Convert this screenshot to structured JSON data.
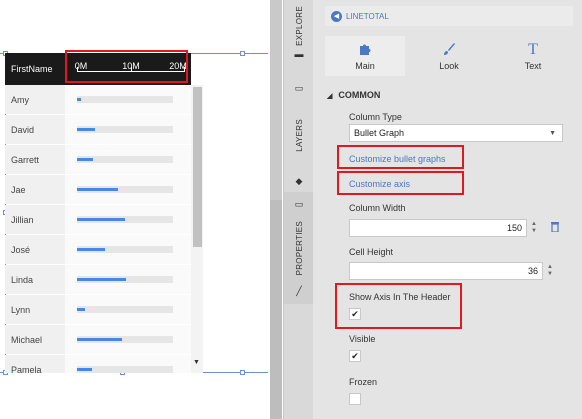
{
  "grid": {
    "header": {
      "first_name": "FirstName"
    },
    "axis": {
      "ticks": [
        "0M",
        "10M",
        "20M"
      ]
    },
    "rows": [
      {
        "name": "Amy",
        "value": 0.04
      },
      {
        "name": "David",
        "value": 0.19
      },
      {
        "name": "Garrett",
        "value": 0.17
      },
      {
        "name": "Jae",
        "value": 0.43
      },
      {
        "name": "Jillian",
        "value": 0.5
      },
      {
        "name": "José",
        "value": 0.29
      },
      {
        "name": "Linda",
        "value": 0.51
      },
      {
        "name": "Lynn",
        "value": 0.08
      },
      {
        "name": "Michael",
        "value": 0.47
      },
      {
        "name": "Pamela",
        "value": 0.16
      }
    ],
    "bar_color": "#4a86e8"
  },
  "side_tabs": {
    "explore": "EXPLORE",
    "layers": "LAYERS",
    "properties": "PROPERTIES"
  },
  "panel": {
    "back_label": "LINETOTAL",
    "tabs": [
      {
        "label": "Main",
        "icon": "puzzle-icon"
      },
      {
        "label": "Look",
        "icon": "brush-icon"
      },
      {
        "label": "Text",
        "icon": "text-icon"
      }
    ],
    "section": "COMMON",
    "column_type": {
      "label": "Column Type",
      "value": "Bullet Graph"
    },
    "customize_bullet_graphs": "Customize bullet graphs",
    "customize_axis": "Customize axis",
    "column_width": {
      "label": "Column Width",
      "value": "150"
    },
    "cell_height": {
      "label": "Cell Height",
      "value": "36"
    },
    "show_axis": {
      "label": "Show Axis In The Header",
      "checked": true
    },
    "visible": {
      "label": "Visible",
      "checked": true
    },
    "frozen": {
      "label": "Frozen",
      "checked": false
    }
  },
  "colors": {
    "accent": "#4a78c2",
    "highlight": "#e0191e"
  }
}
